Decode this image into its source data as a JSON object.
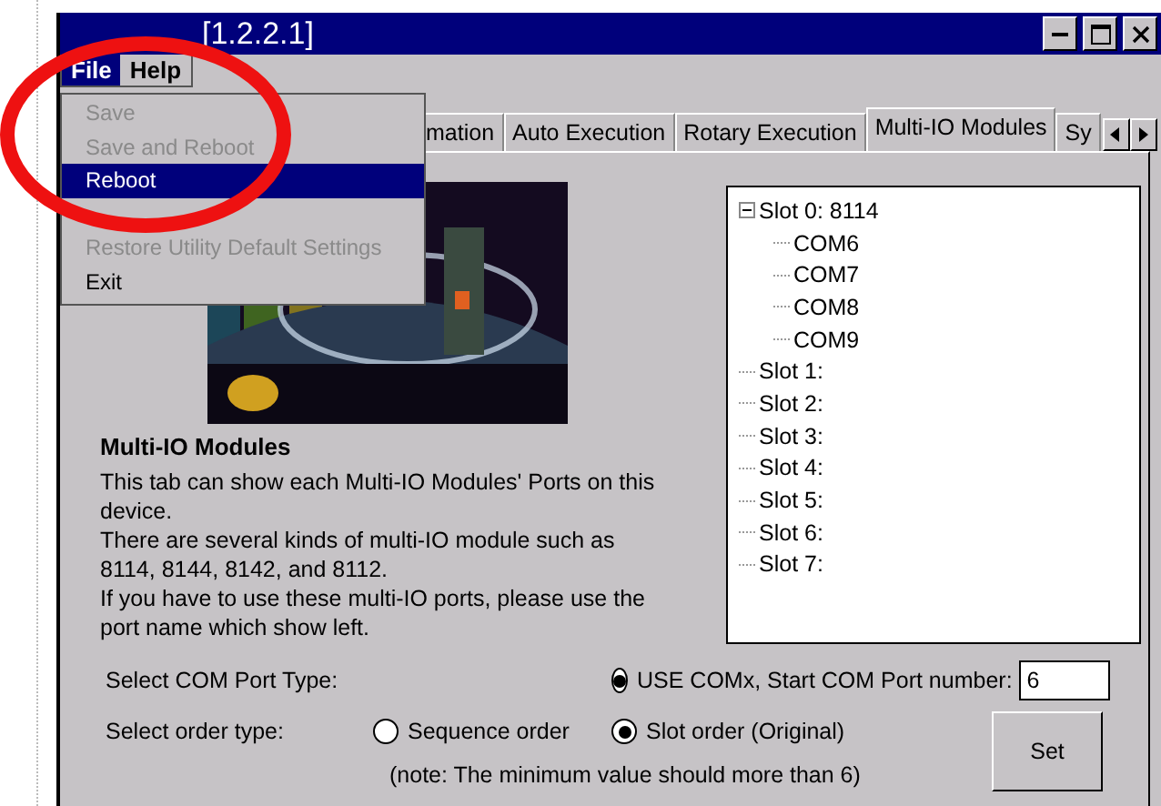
{
  "window": {
    "title": "[1.2.2.1]"
  },
  "menu_bar": [
    {
      "label": "File",
      "selected": true
    },
    {
      "label": "Help",
      "selected": false
    }
  ],
  "file_menu": [
    {
      "kind": "item",
      "label": "Save",
      "disabled": true,
      "selected": false
    },
    {
      "kind": "item",
      "label": "Save and Reboot",
      "disabled": true,
      "selected": false
    },
    {
      "kind": "item",
      "label": "Reboot",
      "disabled": false,
      "selected": true
    },
    {
      "kind": "separator"
    },
    {
      "kind": "item",
      "label": "Restore Utility Default Settings",
      "disabled": true,
      "selected": false
    },
    {
      "kind": "item",
      "label": "Exit",
      "disabled": false,
      "selected": false
    }
  ],
  "tabs": [
    {
      "label": "mation",
      "selected": false
    },
    {
      "label": "Auto Execution",
      "selected": false
    },
    {
      "label": "Rotary Execution",
      "selected": false
    },
    {
      "label": "Multi-IO Modules",
      "selected": true
    },
    {
      "label": "Sy",
      "selected": false
    }
  ],
  "page": {
    "picture": {
      "kind": "picture"
    },
    "heading": "Multi-IO Modules",
    "paragraphs": [
      "This tab can show each Multi-IO Modules' Ports on this device.",
      "There are several kinds of multi-IO module such as 8114, 8144, 8142, and 8112.",
      "If you have to use these multi-IO ports, please use the port name which show left."
    ],
    "tree": [
      {
        "label": "Slot 0: 8114",
        "expanded": true,
        "children": [
          {
            "label": "COM6"
          },
          {
            "label": "COM7"
          },
          {
            "label": "COM8"
          },
          {
            "label": "COM9"
          }
        ]
      },
      {
        "label": "Slot 1:"
      },
      {
        "label": "Slot 2:"
      },
      {
        "label": "Slot 3:"
      },
      {
        "label": "Slot 4:"
      },
      {
        "label": "Slot 5:"
      },
      {
        "label": "Slot 6:"
      },
      {
        "label": "Slot 7:"
      }
    ],
    "com_port_type": {
      "label": "Select COM Port Type:",
      "option": {
        "label": "USE COMx, Start COM Port number:",
        "selected": true
      },
      "start_port": "6"
    },
    "order_type": {
      "label": "Select order type:",
      "options": [
        {
          "label": "Sequence order",
          "selected": false
        },
        {
          "label": "Slot order (Original)",
          "selected": true
        }
      ]
    },
    "note": "(note: The minimum value should more than 6)",
    "set_button": "Set"
  }
}
